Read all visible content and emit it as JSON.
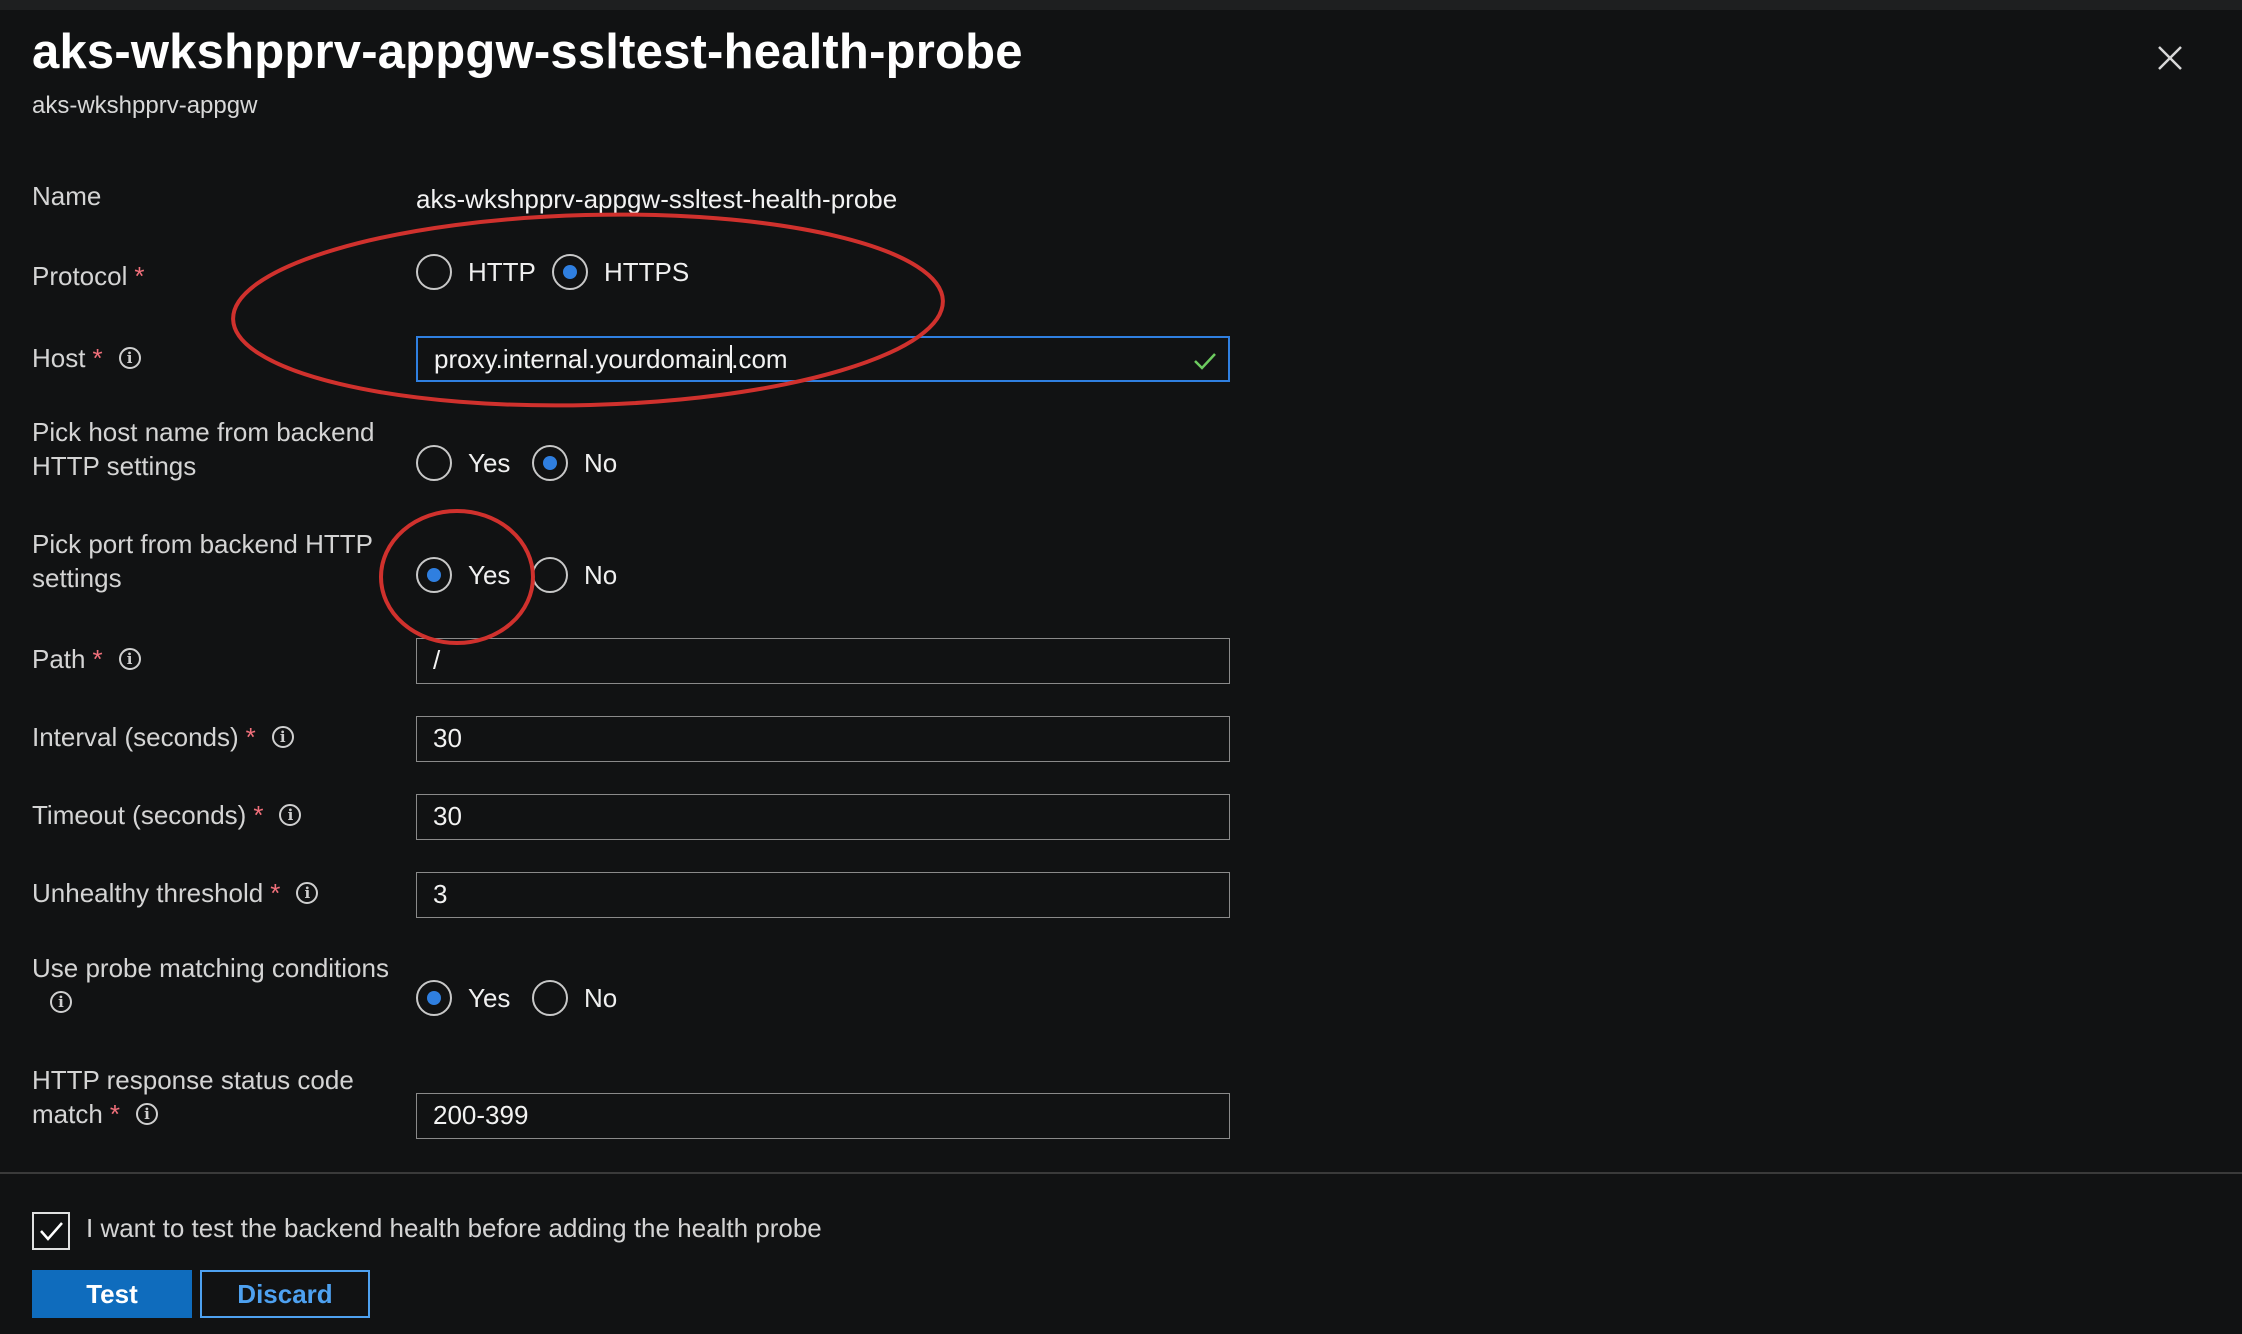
{
  "header": {
    "title": "aks-wkshpprv-appgw-ssltest-health-probe",
    "subtitle": "aks-wkshpprv-appgw"
  },
  "form": {
    "name": {
      "label": "Name",
      "value": "aks-wkshpprv-appgw-ssltest-health-probe"
    },
    "protocol": {
      "label": "Protocol",
      "required": "*",
      "options": [
        "HTTP",
        "HTTPS"
      ],
      "selected": "HTTPS"
    },
    "host": {
      "label": "Host",
      "required": "*",
      "value_before_caret": "proxy.internal.yourdomain",
      "value_after_caret": ".com"
    },
    "pick_host": {
      "label_line1": "Pick host name from backend",
      "label_line2": "HTTP settings",
      "options": [
        "Yes",
        "No"
      ],
      "selected": "No"
    },
    "pick_port": {
      "label_line1": "Pick port from backend HTTP",
      "label_line2": "settings",
      "options": [
        "Yes",
        "No"
      ],
      "selected": "Yes"
    },
    "path": {
      "label": "Path",
      "required": "*",
      "value": "/"
    },
    "interval": {
      "label": "Interval (seconds)",
      "required": "*",
      "value": "30"
    },
    "timeout": {
      "label": "Timeout (seconds)",
      "required": "*",
      "value": "30"
    },
    "unhealthy": {
      "label": "Unhealthy threshold",
      "required": "*",
      "value": "3"
    },
    "probe_matching": {
      "label": "Use probe matching conditions",
      "options": [
        "Yes",
        "No"
      ],
      "selected": "Yes"
    },
    "status_code": {
      "label_line1": "HTTP response status code",
      "label_line2": "match",
      "required": "*",
      "value": "200-399"
    }
  },
  "footer": {
    "test_checkbox_label": "I want to test the backend health before adding the health probe",
    "test_checkbox_checked": true,
    "test_button": "Test",
    "discard_button": "Discard"
  },
  "icons": {
    "close": "close-icon",
    "info": "info-icon",
    "valid": "checkmark-icon"
  },
  "colors": {
    "background": "#111213",
    "accent": "#2f7fe0",
    "primary_button": "#0f6cbd",
    "required_asterisk": "#f1707b",
    "annotation": "#d0312d",
    "valid_check": "#6ccb5f"
  }
}
